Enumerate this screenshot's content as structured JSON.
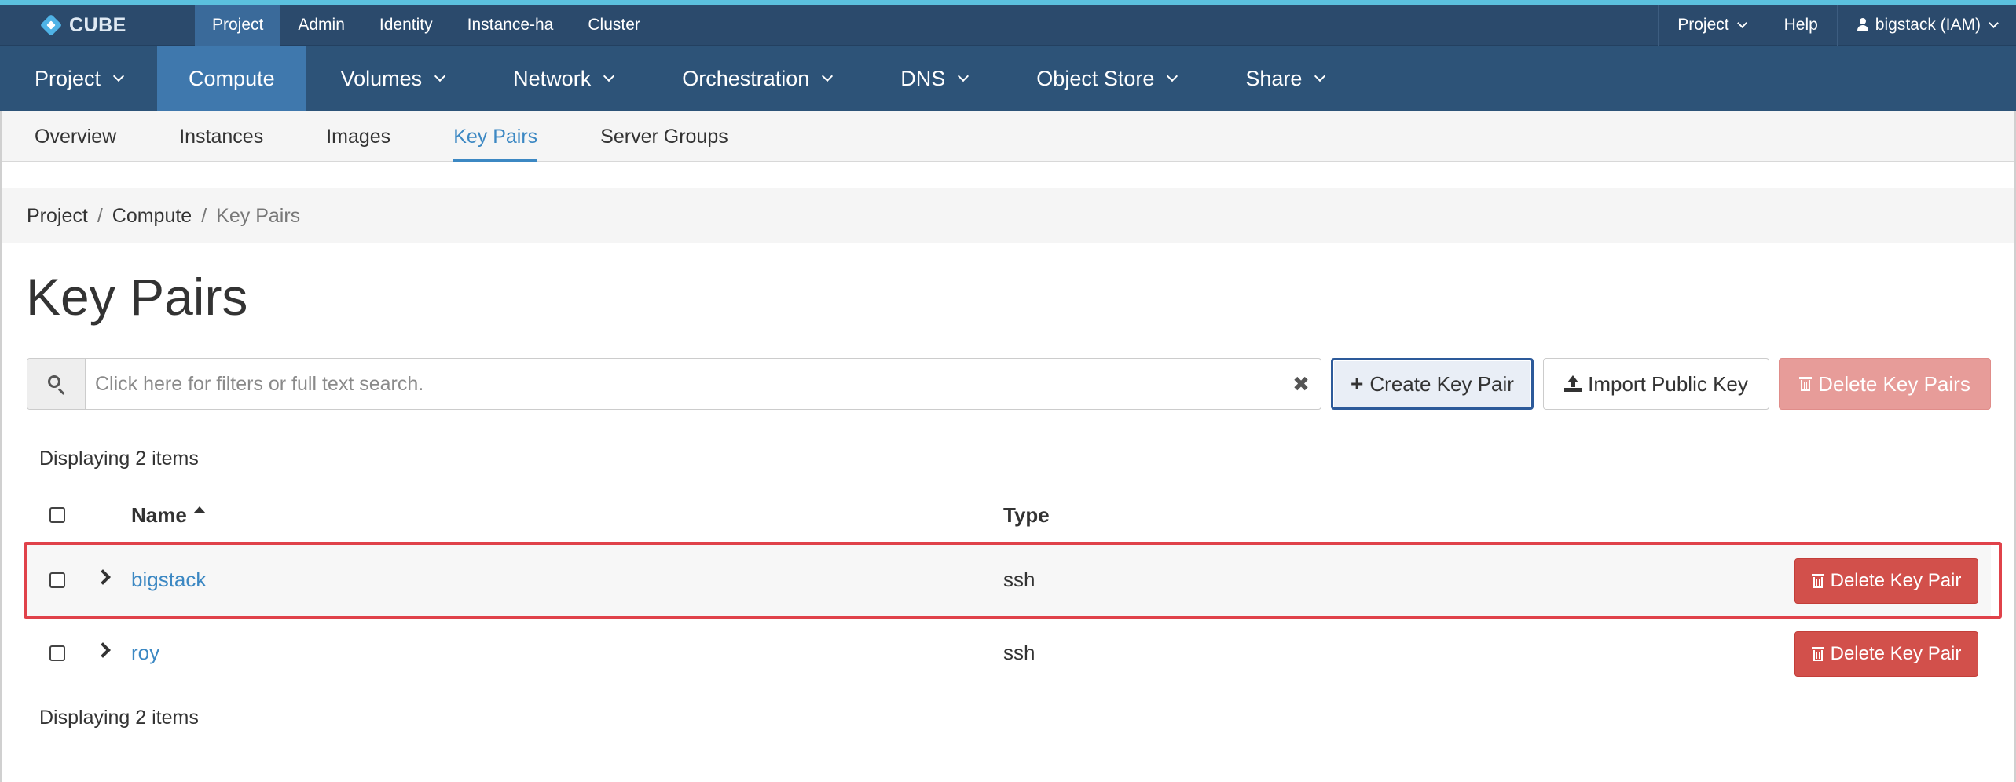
{
  "brand": {
    "name": "CUBE"
  },
  "top_menu": [
    {
      "label": "Project",
      "active": true
    },
    {
      "label": "Admin",
      "active": false
    },
    {
      "label": "Identity",
      "active": false
    },
    {
      "label": "Instance-ha",
      "active": false
    },
    {
      "label": "Cluster",
      "active": false
    }
  ],
  "top_right": {
    "project_label": "Project",
    "help_label": "Help",
    "user_label": "bigstack (IAM)"
  },
  "main_menu": [
    {
      "label": "Project",
      "active": false,
      "has_caret": true
    },
    {
      "label": "Compute",
      "active": true,
      "has_caret": false
    },
    {
      "label": "Volumes",
      "active": false,
      "has_caret": true
    },
    {
      "label": "Network",
      "active": false,
      "has_caret": true
    },
    {
      "label": "Orchestration",
      "active": false,
      "has_caret": true
    },
    {
      "label": "DNS",
      "active": false,
      "has_caret": true
    },
    {
      "label": "Object Store",
      "active": false,
      "has_caret": true
    },
    {
      "label": "Share",
      "active": false,
      "has_caret": true
    }
  ],
  "sub_menu": [
    {
      "label": "Overview",
      "active": false
    },
    {
      "label": "Instances",
      "active": false
    },
    {
      "label": "Images",
      "active": false
    },
    {
      "label": "Key Pairs",
      "active": true
    },
    {
      "label": "Server Groups",
      "active": false
    }
  ],
  "breadcrumb": {
    "items": [
      "Project",
      "Compute"
    ],
    "separator": "/",
    "current": "Key Pairs"
  },
  "page_title": "Key Pairs",
  "search": {
    "placeholder": "Click here for filters or full text search.",
    "value": "",
    "clear_glyph": "✖"
  },
  "actions": {
    "create_label": "Create Key Pair",
    "import_label": "Import Public Key",
    "delete_all_label": "Delete Key Pairs"
  },
  "table": {
    "count_text": "Displaying 2 items",
    "columns": {
      "name": "Name",
      "type": "Type"
    },
    "sort": {
      "column": "Name",
      "direction": "ascending"
    },
    "rows": [
      {
        "name": "bigstack",
        "type": "ssh",
        "action_label": "Delete Key Pair",
        "highlighted": true
      },
      {
        "name": "roy",
        "type": "ssh",
        "action_label": "Delete Key Pair",
        "highlighted": false
      }
    ]
  },
  "colors": {
    "topbar": "#2b4a6c",
    "mainbar": "#2d5378",
    "active_main": "#3f78ad",
    "link": "#3c88c3",
    "danger": "#d2504b",
    "highlight_outline": "#e0424a",
    "accent_strip": "#5bc0de"
  },
  "icons": {
    "brand": "cube-diamond-logo",
    "user": "user-icon",
    "search": "search-icon",
    "clear": "clear-icon",
    "create": "plus-icon",
    "import": "upload-icon",
    "delete": "trash-icon",
    "expand": "chevron-right-icon",
    "sort": "sort-ascending-icon"
  }
}
